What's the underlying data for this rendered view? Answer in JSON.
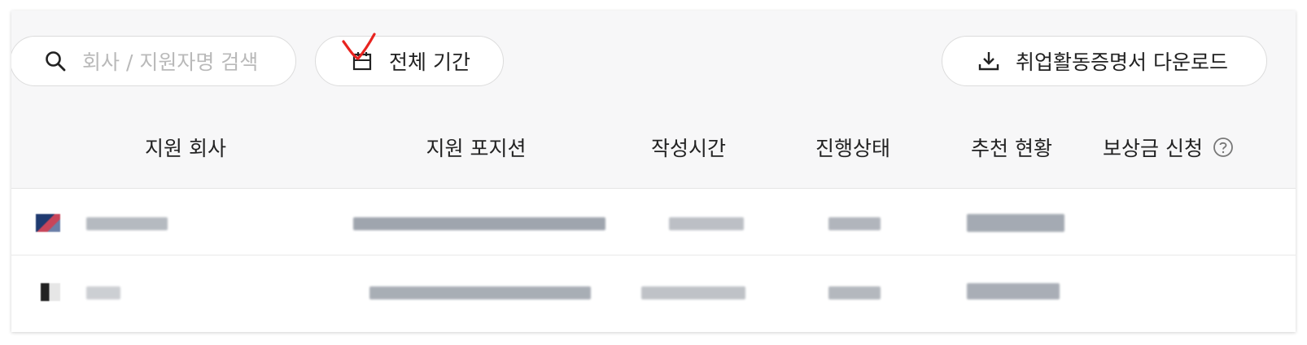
{
  "toolbar": {
    "search_placeholder": "회사 / 지원자명 검색",
    "period_label": "전체 기간",
    "download_label": "취업활동증명서 다운로드"
  },
  "table": {
    "headers": [
      "지원 회사",
      "지원 포지션",
      "작성시간",
      "진행상태",
      "추천 현황",
      "보상금 신청"
    ]
  },
  "colors": {
    "header_bg": "#f7f7f8",
    "annotation_red": "#e8231f"
  }
}
